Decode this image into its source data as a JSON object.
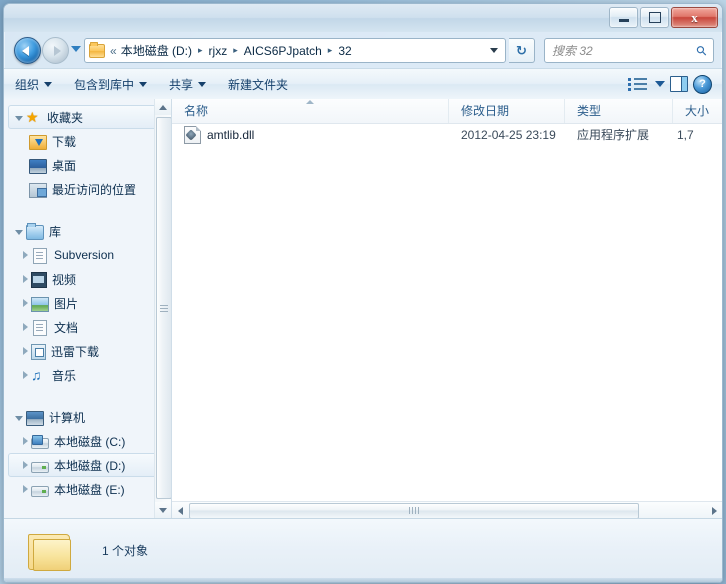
{
  "window": {
    "controls": {
      "minimize": "–",
      "maximize": "□",
      "close": "x"
    }
  },
  "address": {
    "chevron": "«",
    "separator": "▸",
    "crumbs": [
      "本地磁盘 (D:)",
      "rjxz",
      "AICS6PJpatch",
      "32"
    ],
    "folder_icon": "folder-icon",
    "dropdown_icon": "chevron-down-icon",
    "refresh_icon": "↻",
    "back_icon": "back-arrow-icon",
    "forward_icon": "forward-arrow-icon",
    "history_icon": "history-dropdown-icon"
  },
  "search": {
    "placeholder": "搜索 32",
    "icon": "search-icon"
  },
  "toolbar": {
    "organize": "组织",
    "include_in_library": "包含到库中",
    "share": "共享",
    "new_folder": "新建文件夹",
    "view_icon": "view-options-icon",
    "preview_pane_icon": "preview-pane-icon",
    "help_icon": "?"
  },
  "sidebar": {
    "groups": [
      {
        "label": "收藏夹",
        "icon": "star-icon",
        "expanded": true,
        "selected": true,
        "items": [
          {
            "label": "下载",
            "icon": "downloads-icon"
          },
          {
            "label": "桌面",
            "icon": "desktop-icon"
          },
          {
            "label": "最近访问的位置",
            "icon": "recent-places-icon"
          }
        ]
      },
      {
        "label": "库",
        "icon": "library-icon",
        "expanded": true,
        "items": [
          {
            "label": "Subversion",
            "icon": "document-library-icon"
          },
          {
            "label": "视频",
            "icon": "video-library-icon"
          },
          {
            "label": "图片",
            "icon": "pictures-library-icon"
          },
          {
            "label": "文档",
            "icon": "documents-library-icon"
          },
          {
            "label": "迅雷下载",
            "icon": "thunder-download-icon"
          },
          {
            "label": "音乐",
            "icon": "music-library-icon"
          }
        ]
      },
      {
        "label": "计算机",
        "icon": "computer-icon",
        "expanded": true,
        "items": [
          {
            "label": "本地磁盘 (C:)",
            "icon": "system-drive-icon"
          },
          {
            "label": "本地磁盘 (D:)",
            "icon": "drive-icon",
            "selected": true
          },
          {
            "label": "本地磁盘 (E:)",
            "icon": "drive-icon"
          }
        ]
      }
    ],
    "scrollbar": {
      "up_icon": "scroll-up-icon",
      "down_icon": "scroll-down-icon"
    }
  },
  "filelist": {
    "columns": [
      {
        "label": "名称",
        "sorted": "asc"
      },
      {
        "label": "修改日期"
      },
      {
        "label": "类型"
      },
      {
        "label": "大小"
      }
    ],
    "rows": [
      {
        "name": "amtlib.dll",
        "icon": "dll-file-icon",
        "modified": "2012-04-25 23:19",
        "type": "应用程序扩展",
        "size": "1,7"
      }
    ],
    "hscroll": {
      "left_icon": "scroll-left-icon",
      "right_icon": "scroll-right-icon"
    }
  },
  "statusbar": {
    "text": "1 个对象",
    "icon": "folder-icon"
  }
}
